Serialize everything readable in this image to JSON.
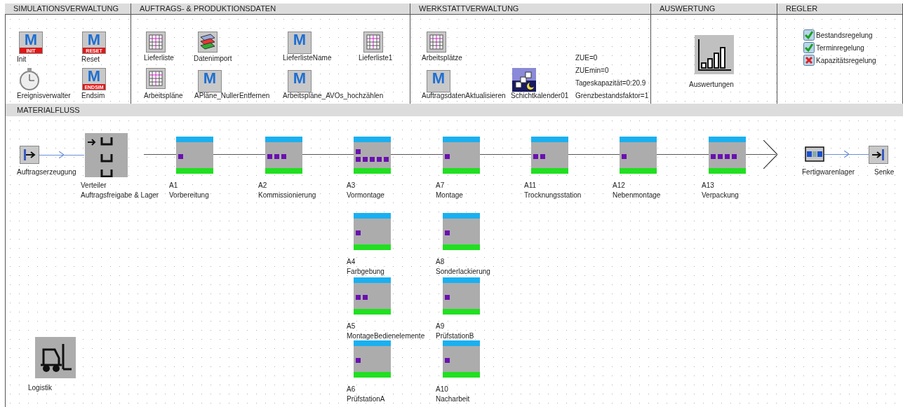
{
  "sections": [
    {
      "title": "SIMULATIONSVERWALTUNG",
      "items": [
        {
          "kind": "method",
          "letter": "M",
          "badge": "INIT",
          "label": "Init"
        },
        {
          "kind": "clock",
          "label": "Ereignisverwalter"
        },
        {
          "kind": "method",
          "letter": "M",
          "badge": "RESET",
          "label": "Reset"
        },
        {
          "kind": "method",
          "letter": "M",
          "badge": "ENDSIM",
          "label": "Endsim"
        }
      ]
    },
    {
      "title": "AUFTRAGS- & PRODUKTIONSDATEN",
      "items": [
        {
          "kind": "table",
          "label": "Lieferliste"
        },
        {
          "kind": "import",
          "label": "Datenimport"
        },
        {
          "kind": "method",
          "letter": "M",
          "label": "LieferlisteName"
        },
        {
          "kind": "table",
          "label": "Lieferliste1"
        },
        {
          "kind": "table",
          "label": "Arbeitspläne"
        },
        {
          "kind": "method",
          "letter": "M",
          "label": "APläne_NullerEntfernen"
        },
        {
          "kind": "method",
          "letter": "M",
          "label": "Arbeitspläne_AVOs_hochzählen"
        }
      ]
    },
    {
      "title": "WERKSTATTVERWALTUNG",
      "items": [
        {
          "kind": "table",
          "label": "Arbeitsplätze"
        },
        {
          "kind": "method",
          "letter": "M",
          "label": "AuftragsdatenAktualisieren"
        },
        {
          "kind": "calendar",
          "label": "Schichtkalender01"
        },
        {
          "kind": "variable",
          "label": "ZUE=0"
        },
        {
          "kind": "variable",
          "label": "ZUEmin=0"
        },
        {
          "kind": "variable",
          "label": "Tageskapazität=0:20.9"
        },
        {
          "kind": "variable",
          "label": "Grenzbestandsfaktor=1"
        }
      ]
    },
    {
      "title": "AUSWERTUNG",
      "items": [
        {
          "kind": "chart",
          "label": "Auswertungen"
        }
      ]
    },
    {
      "title": "REGLER",
      "items": [
        {
          "kind": "checkbox",
          "label": "Bestandsregelung",
          "checked": true
        },
        {
          "kind": "checkbox",
          "label": "Terminregelung",
          "checked": true
        },
        {
          "kind": "checkbox",
          "label": "Kapazitätsregelung",
          "checked": false
        }
      ]
    }
  ],
  "materialfluss": {
    "title": "MATERIALFLUSS",
    "source": {
      "label": "Auftragserzeugung"
    },
    "distributor": {
      "label": "Verteiler",
      "sublabel": "Auftragsfreigabe & Lager"
    },
    "stations": [
      {
        "id": "A1",
        "name": "Vorbereitung",
        "parts": [
          {
            "kind": "bottom"
          }
        ]
      },
      {
        "id": "A2",
        "name": "Kommissionierung",
        "parts": [
          {
            "kind": "bottom"
          },
          {
            "kind": "bottom"
          },
          {
            "kind": "bottom"
          }
        ]
      },
      {
        "id": "A3",
        "name": "Vormontage",
        "parts": [
          {
            "kind": "top"
          },
          {
            "kind": "bottom"
          },
          {
            "kind": "bottom"
          },
          {
            "kind": "bottom"
          },
          {
            "kind": "bottom"
          },
          {
            "kind": "bottom"
          }
        ]
      },
      {
        "id": "A7",
        "name": "Montage",
        "parts": [
          {
            "kind": "bottom"
          }
        ]
      },
      {
        "id": "A11",
        "name": "Trocknungsstation",
        "parts": [
          {
            "kind": "bottom"
          },
          {
            "kind": "bottom"
          }
        ]
      },
      {
        "id": "A12",
        "name": "Nebenmontage",
        "parts": [
          {
            "kind": "bottom"
          }
        ]
      },
      {
        "id": "A13",
        "name": "Verpackung",
        "parts": [
          {
            "kind": "bottom"
          },
          {
            "kind": "bottom"
          },
          {
            "kind": "bottom"
          },
          {
            "kind": "bottom"
          }
        ]
      },
      {
        "id": "A4",
        "name": "Farbgebung",
        "parts": [
          {
            "kind": "bottom"
          }
        ]
      },
      {
        "id": "A8",
        "name": "Sonderlackierung",
        "parts": [
          {
            "kind": "bottom"
          }
        ]
      },
      {
        "id": "A5",
        "name": "MontageBedienelemente",
        "parts": [
          {
            "kind": "bottom"
          },
          {
            "kind": "bottom"
          }
        ]
      },
      {
        "id": "A9",
        "name": "PrüfstationB",
        "parts": [
          {
            "kind": "bottom"
          }
        ]
      },
      {
        "id": "A6",
        "name": "PrüfstationA",
        "parts": [
          {
            "kind": "bottom"
          }
        ]
      },
      {
        "id": "A10",
        "name": "Nacharbeit",
        "parts": [
          {
            "kind": "bottom"
          }
        ]
      }
    ],
    "store": {
      "label": "Fertigwarenlager"
    },
    "sink": {
      "label": "Senke"
    },
    "logistics": {
      "label": "Logistik"
    }
  }
}
